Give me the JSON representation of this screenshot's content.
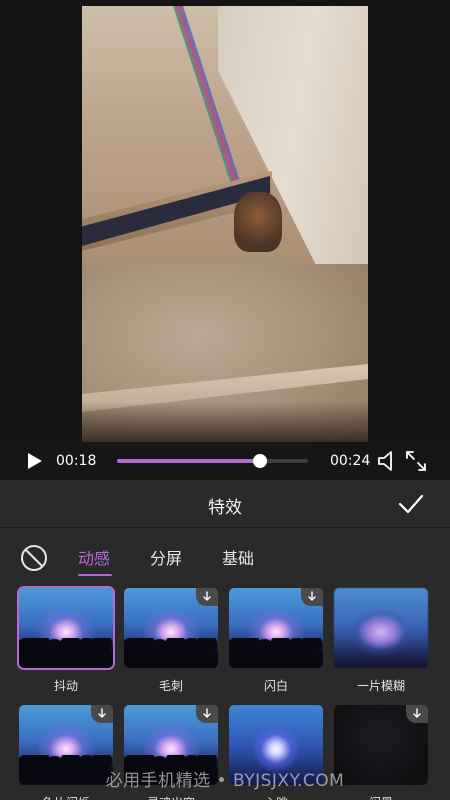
{
  "player": {
    "current_time": "00:18",
    "total_time": "00:24",
    "progress": 0.75
  },
  "panel": {
    "title": "特效",
    "tabs": [
      {
        "label": "动感",
        "active": true
      },
      {
        "label": "分屏",
        "active": false
      },
      {
        "label": "基础",
        "active": false
      }
    ]
  },
  "effects": [
    {
      "label": "抖动",
      "thumb": "concert",
      "selected": true,
      "download": false
    },
    {
      "label": "毛刺",
      "thumb": "concert",
      "selected": false,
      "download": true
    },
    {
      "label": "闪白",
      "thumb": "concert",
      "selected": false,
      "download": true
    },
    {
      "label": "一片模糊",
      "thumb": "blurred",
      "selected": false,
      "download": false
    },
    {
      "label": "鱼片闪烁",
      "thumb": "concert",
      "selected": false,
      "download": true
    },
    {
      "label": "灵魂出窍",
      "thumb": "concert",
      "selected": false,
      "download": true
    },
    {
      "label": "心跳",
      "thumb": "zoomed",
      "selected": false,
      "download": false
    },
    {
      "label": "闪黑",
      "thumb": "dark",
      "selected": false,
      "download": true
    }
  ],
  "watermark": "必用手机精选 • BYJSJXY.COM",
  "colors": {
    "accent": "#b56ad9",
    "panel_bg": "#2a2a2a",
    "page_bg": "#161616"
  }
}
